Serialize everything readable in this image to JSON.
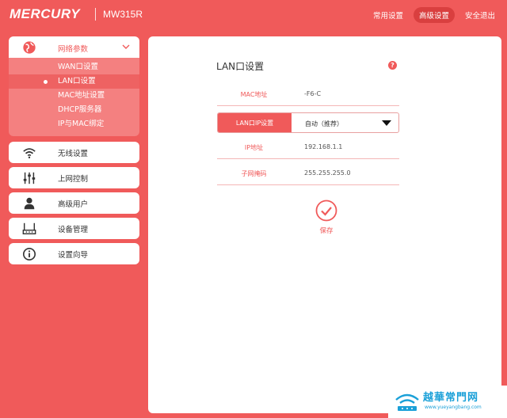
{
  "header": {
    "logo": "MERCURY",
    "model": "MW315R",
    "nav": [
      {
        "label": "常用设置",
        "active": false
      },
      {
        "label": "高级设置",
        "active": true
      },
      {
        "label": "安全退出",
        "active": false
      }
    ]
  },
  "sidebar": {
    "open_group": {
      "label": "网络参数",
      "icon": "globe-icon",
      "items": [
        {
          "label": "WAN口设置",
          "active": false
        },
        {
          "label": "LAN口设置",
          "active": true
        },
        {
          "label": "MAC地址设置",
          "active": false
        },
        {
          "label": "DHCP服务器",
          "active": false
        },
        {
          "label": "IP与MAC绑定",
          "active": false
        }
      ]
    },
    "groups": [
      {
        "label": "无线设置",
        "icon": "wifi-icon"
      },
      {
        "label": "上网控制",
        "icon": "sliders-icon"
      },
      {
        "label": "高级用户",
        "icon": "user-icon"
      },
      {
        "label": "设备管理",
        "icon": "router-icon"
      },
      {
        "label": "设置向导",
        "icon": "info-icon"
      }
    ]
  },
  "main": {
    "title": "LAN口设置",
    "help": "?",
    "mac": {
      "label": "MAC地址",
      "value": "-F6-C"
    },
    "ip_mode": {
      "label": "LAN口IP设置",
      "selected": "自动（推荐）"
    },
    "ip": {
      "label": "IP地址",
      "value": "192.168.1.1"
    },
    "mask": {
      "label": "子网掩码",
      "value": "255.255.255.0"
    },
    "save_label": "保存"
  },
  "watermark": {
    "title": "越華常門网",
    "url": "www.yueyangbang.com"
  },
  "colors": {
    "accent": "#f05a5a",
    "submenu_bg": "#f48080",
    "watermark": "#1aa0d8"
  }
}
